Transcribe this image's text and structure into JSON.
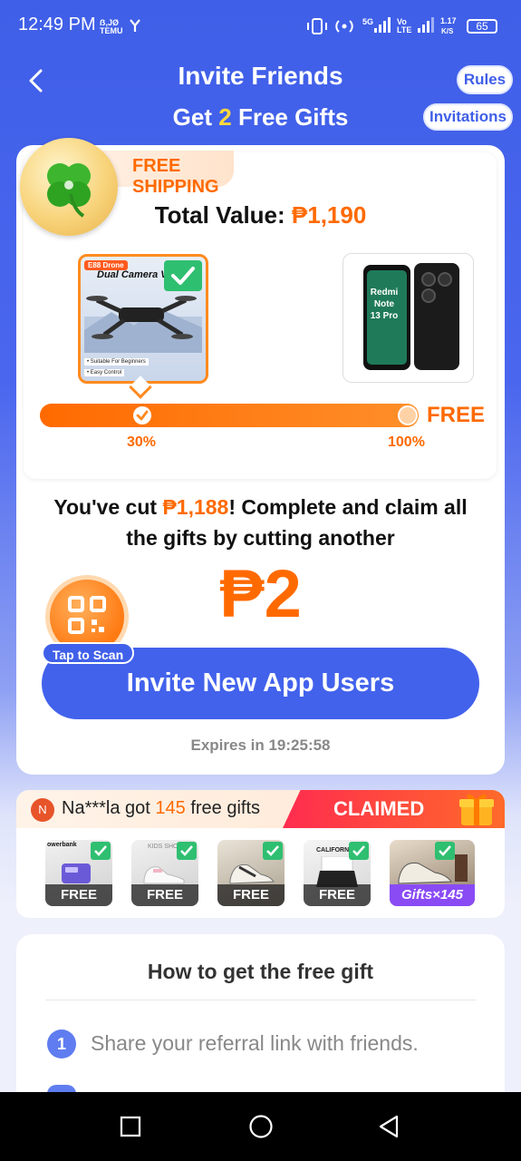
{
  "status_bar": {
    "time": "12:49 PM",
    "network_speed_value": "1.17",
    "network_speed_unit": "K/S",
    "battery": "65",
    "signal_label": "5G",
    "volte_label": "Vo LTE",
    "notif_text": "ẞ,JØ TEMU"
  },
  "header": {
    "title": "Invite Friends",
    "subtitle_pre": "Get ",
    "subtitle_num": "2",
    "subtitle_post": " Free Gifts",
    "rules_label": "Rules",
    "invitations_label": "Invitations"
  },
  "main_card": {
    "shipping_tag": "FREE SHIPPING",
    "total_label": "Total Value: ",
    "total_value": "₱1,190",
    "product1": {
      "tag": "E88 Drone",
      "title": "Dual Camera V",
      "bullet1": "• Suitable For Beginners",
      "bullet2": "• Easy Control"
    },
    "product2": {
      "screen_text": "Redmi Note 13 Pro"
    },
    "progress": {
      "fraction": 1.0,
      "marker1_pct": 0.27,
      "label1": "30%",
      "label2": "100%",
      "end_label": "FREE"
    },
    "cut_pre": "You've cut ",
    "cut_value": "₱1,188",
    "cut_post": "! Complete and claim all the gifts by cutting another",
    "remaining": "₱2",
    "scan_label": "Tap to Scan",
    "invite_button": "Invite New App Users",
    "expires": "Expires in 19:25:58"
  },
  "claimed": {
    "avatar_letter": "N",
    "user": "Na***la got ",
    "count": "145",
    "suffix": " free gifts",
    "badge": "CLAIMED",
    "thumbs": [
      {
        "label": "FREE",
        "caption": "owerbank"
      },
      {
        "label": "FREE",
        "caption": "KIDS SHO"
      },
      {
        "label": "FREE",
        "caption": ""
      },
      {
        "label": "FREE",
        "caption": "CALIFORNIA"
      },
      {
        "label": "Gifts×145",
        "caption": ""
      }
    ]
  },
  "howto": {
    "title": "How to get the free gift",
    "step1_num": "1",
    "step1_text": "Share your referral link with friends."
  },
  "colors": {
    "primary": "#4262ec",
    "accent": "#ff6a00",
    "claimed_red": "#ff2c4f"
  }
}
